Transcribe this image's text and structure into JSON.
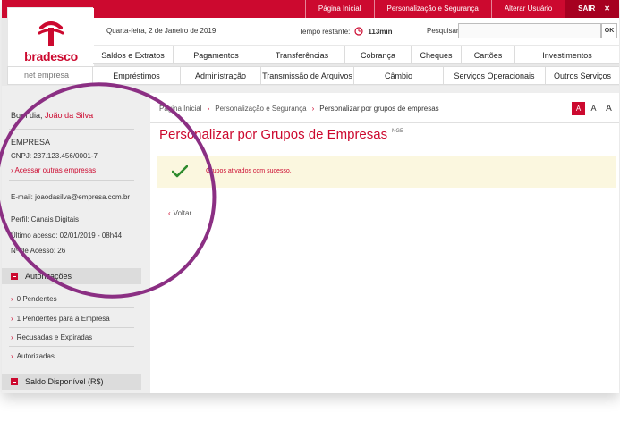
{
  "header": {
    "links": [
      "Página Inicial",
      "Personalização e Segurança",
      "Alterar Usuário"
    ],
    "logout": "SAIR",
    "date": "Quarta-feira, 2 de Janeiro de 2019",
    "session_label": "Tempo restante:",
    "session_time": "113min",
    "search_label": "Pesquisar:",
    "search_value": "",
    "search_button": "OK"
  },
  "brand": {
    "name": "bradesco",
    "product": "net empresa",
    "accent": "#cc092f"
  },
  "nav": {
    "row1": [
      "Saldos e Extratos",
      "Pagamentos",
      "Transferências",
      "Cobrança",
      "Cheques",
      "Cartões",
      "Investimentos"
    ],
    "row2": [
      "Empréstimos",
      "Administração",
      "Transmissão de Arquivos",
      "Câmbio",
      "Serviços Operacionais",
      "Outros Serviços"
    ]
  },
  "sidebar": {
    "greeting": "Bom dia,",
    "user_name": "João da Silva",
    "company_label": "EMPRESA",
    "cnpj": "CNPJ: 237.123.456/0001-7",
    "other_companies": "Acessar outras empresas",
    "email": "E-mail: joaodasilva@empresa.com.br",
    "profile": "Perfil: Canais Digitais",
    "last_access": "Último acesso: 02/01/2019 - 08h44",
    "access_count": "Nº de Acesso: 26",
    "authorizations": {
      "title": "Autorizações",
      "items": [
        "0 Pendentes",
        "1 Pendentes para a Empresa",
        "Recusadas e Expiradas",
        "Autorizadas"
      ]
    },
    "balance_title": "Saldo Disponível (R$)"
  },
  "main": {
    "breadcrumb": [
      "Página Inicial",
      "Personalização e Segurança",
      "Personalizar por grupos de empresas"
    ],
    "font_buttons": [
      "A",
      "A",
      "A"
    ],
    "title": "Personalizar por Grupos de Empresas",
    "code": "NGE",
    "success_message": "Grupos ativados com sucesso.",
    "back": "Voltar"
  }
}
